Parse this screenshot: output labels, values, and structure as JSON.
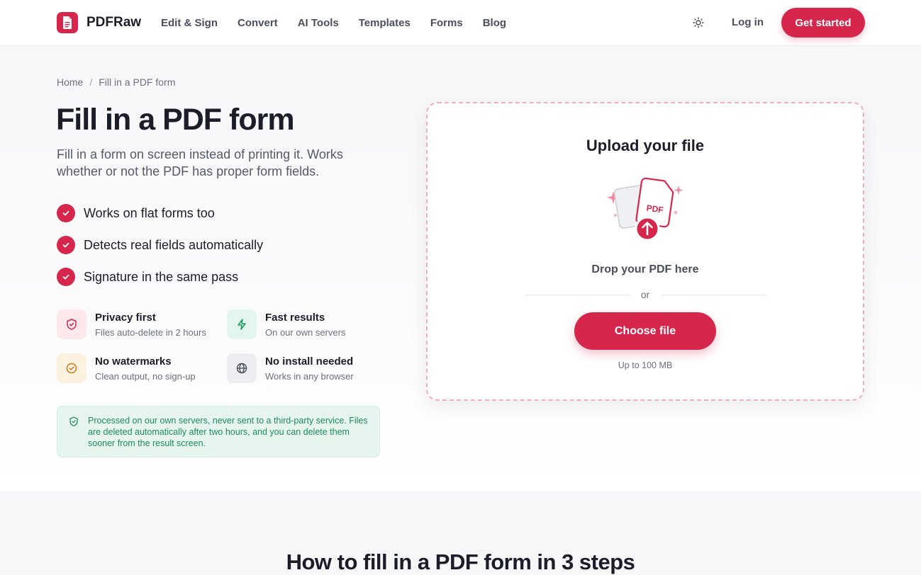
{
  "brand": {
    "name": "PDFRaw",
    "accent": "#d7264b"
  },
  "nav": {
    "items": [
      "Edit & Sign",
      "Convert",
      "AI Tools",
      "Templates",
      "Forms",
      "Blog"
    ],
    "login": "Log in",
    "cta": "Get started"
  },
  "breadcrumb": {
    "home": "Home",
    "separator": "/",
    "current": "Fill in a PDF form"
  },
  "hero": {
    "title": "Fill in a PDF form",
    "subtitle": "Fill in a form on screen instead of printing it. Works whether or not the PDF has proper form fields.",
    "checks": [
      "Works on flat forms too",
      "Detects real fields automatically",
      "Signature in the same pass"
    ],
    "features": [
      {
        "title": "Privacy first",
        "desc": "Files auto-delete in 2 hours",
        "icon": "shield-icon"
      },
      {
        "title": "Fast results",
        "desc": "On our own servers",
        "icon": "lightning-icon"
      },
      {
        "title": "No watermarks",
        "desc": "Clean output, no sign-up",
        "icon": "check-circle-icon"
      },
      {
        "title": "No install needed",
        "desc": "Works in any browser",
        "icon": "globe-icon"
      }
    ],
    "notice": "Processed on our own servers, never sent to a third-party service. Files are deleted automatically after two hours, and you can delete them sooner from the result screen."
  },
  "upload": {
    "title": "Upload your file",
    "badge": "PDF",
    "drop": "Drop your PDF here",
    "or": "or",
    "button": "Choose file",
    "limit": "Up to 100 MB"
  },
  "steps": {
    "title": "How to fill in a PDF form in 3 steps"
  }
}
